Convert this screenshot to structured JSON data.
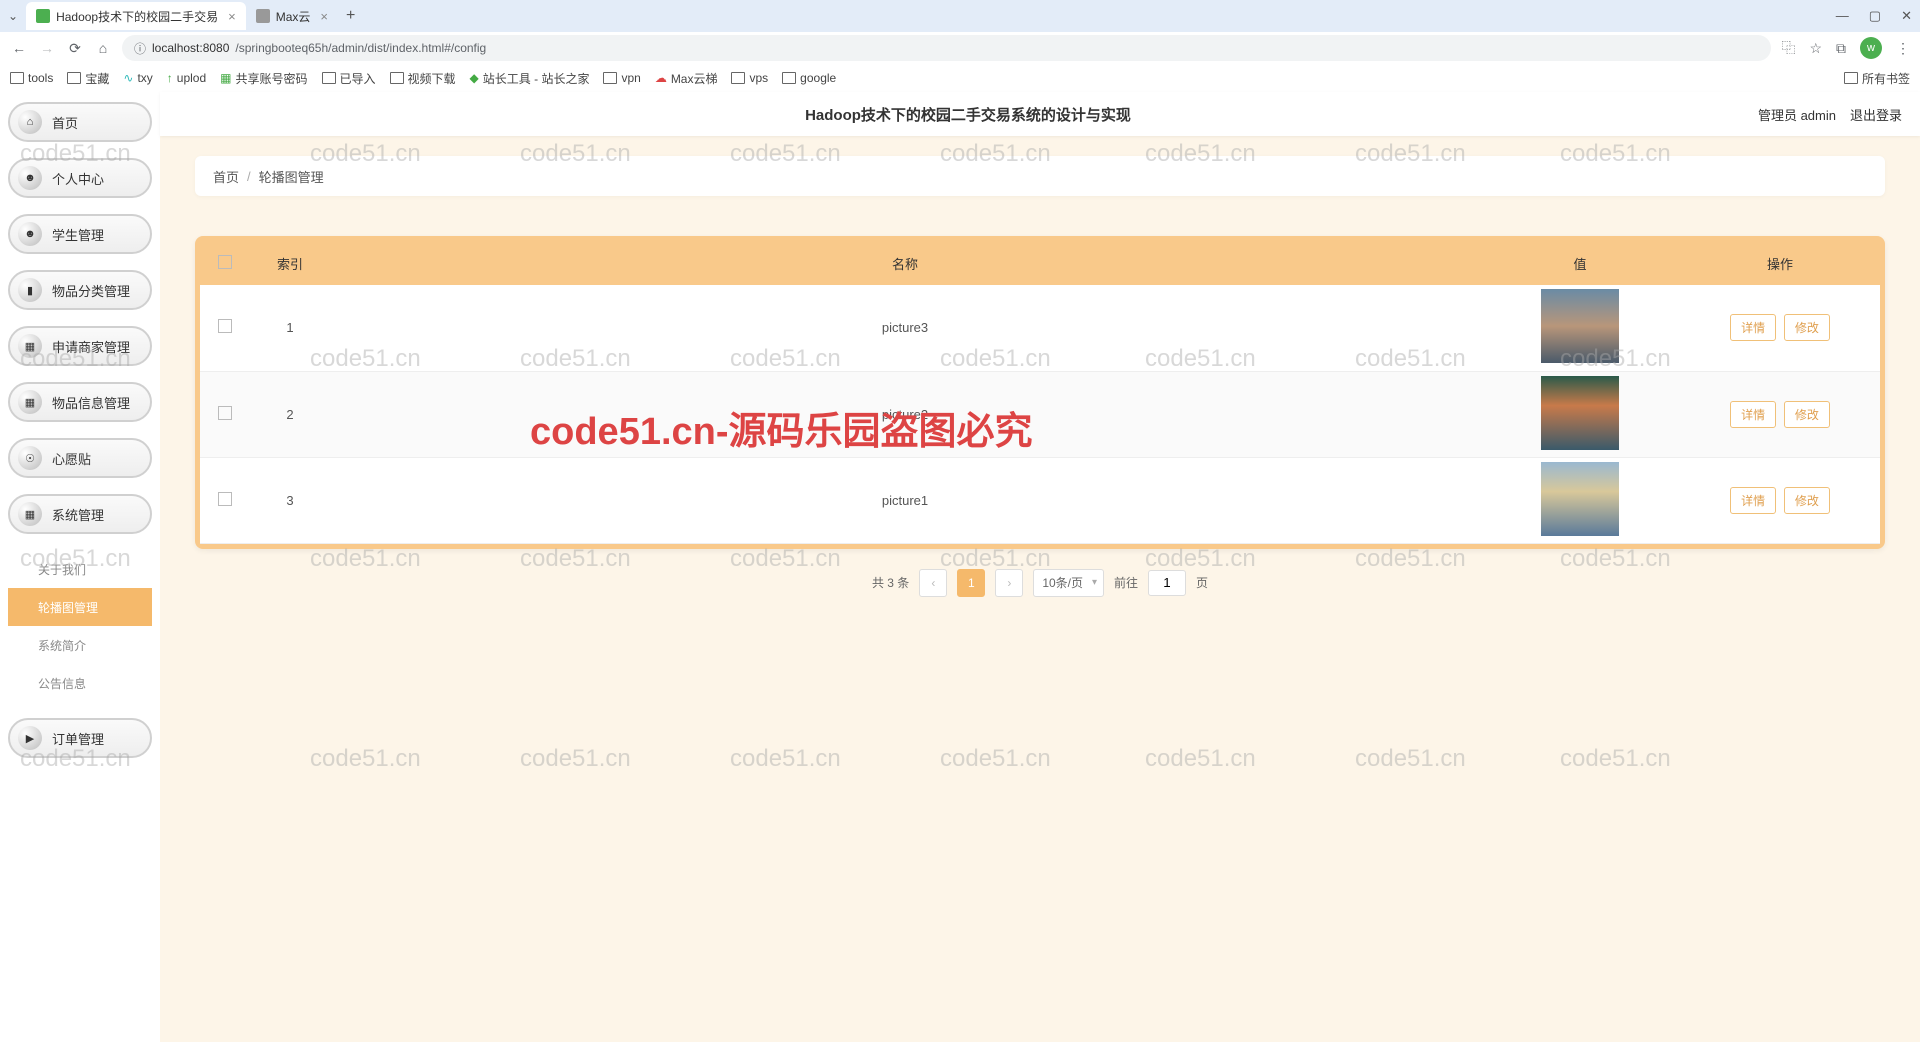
{
  "browser": {
    "tabs": [
      {
        "title": "Hadoop技术下的校园二手交易",
        "active": true
      },
      {
        "title": "Max云",
        "active": false
      }
    ],
    "url_prefix": "localhost:8080",
    "url_path": "/springbooteq65h/admin/dist/index.html#/config",
    "bookmarks": [
      "tools",
      "宝藏",
      "txy",
      "uplod",
      "共享账号密码",
      "已导入",
      "视频下载",
      "站长工具 - 站长之家",
      "vpn",
      "Max云梯",
      "vps",
      "google"
    ],
    "bookmark_right": "所有书签"
  },
  "header": {
    "title": "Hadoop技术下的校园二手交易系统的设计与实现",
    "user": "管理员 admin",
    "logout": "退出登录"
  },
  "sidebar": {
    "items": [
      {
        "label": "首页"
      },
      {
        "label": "个人中心"
      },
      {
        "label": "学生管理"
      },
      {
        "label": "物品分类管理"
      },
      {
        "label": "申请商家管理"
      },
      {
        "label": "物品信息管理"
      },
      {
        "label": "心愿贴"
      },
      {
        "label": "系统管理"
      }
    ],
    "subitems": [
      {
        "label": "关于我们",
        "active": false
      },
      {
        "label": "轮播图管理",
        "active": true
      },
      {
        "label": "系统简介",
        "active": false
      },
      {
        "label": "公告信息",
        "active": false
      }
    ],
    "last_item": {
      "label": "订单管理"
    }
  },
  "breadcrumb": {
    "home": "首页",
    "current": "轮播图管理"
  },
  "table": {
    "headers": {
      "index": "索引",
      "name": "名称",
      "value": "值",
      "action": "操作"
    },
    "rows": [
      {
        "idx": "1",
        "name": "picture3"
      },
      {
        "idx": "2",
        "name": "picture2"
      },
      {
        "idx": "3",
        "name": "picture1"
      }
    ],
    "btn_detail": "详情",
    "btn_edit": "修改"
  },
  "pager": {
    "total": "共 3 条",
    "current": "1",
    "page_size": "10条/页",
    "goto_prefix": "前往",
    "goto_val": "1",
    "goto_suffix": "页"
  },
  "watermark": {
    "text": "code51.cn",
    "big": "code51.cn-源码乐园盗图必究"
  }
}
